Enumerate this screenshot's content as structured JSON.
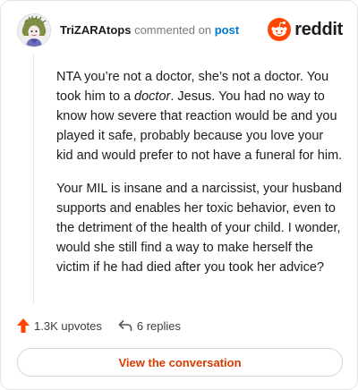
{
  "comment": {
    "username": "TriZARAtops",
    "verb": "commented on",
    "post_link": "post",
    "paragraph_1": {
      "before": "NTA you’re not a doctor, she’s not a doctor. You took him to a ",
      "emphasis": "doctor",
      "after": ". Jesus. You had no way to know how severe that reaction would be and you played it safe, probably because you love your kid and would prefer to not have a funeral for him."
    },
    "paragraph_2": "Your MIL is insane and a narcissist, your husband supports and enables her toxic behavior, even to the detriment of the health of your child. I wonder, would she still find a way to make herself the victim if he had died after you took her advice?"
  },
  "brand": {
    "wordmark": "reddit",
    "icon": "reddit-snoo-icon",
    "color": "#ff4500"
  },
  "footer": {
    "upvotes": "1.3K upvotes",
    "replies": "6 replies",
    "upvote_icon": "upvote-arrow-icon",
    "reply_icon": "reply-arrow-icon"
  },
  "cta": {
    "label": "View the conversation",
    "color": "#d93a00"
  },
  "colors": {
    "link": "#0079d3",
    "upvote": "#ff4500",
    "muted": "#7c7c7c"
  }
}
